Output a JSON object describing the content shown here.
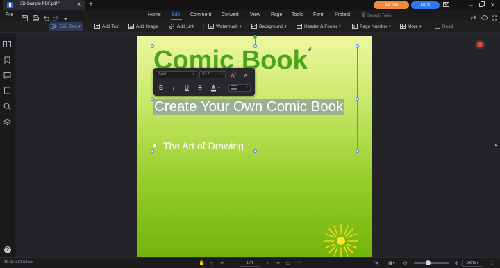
{
  "window": {
    "tab_title": "3D-Sample PDF.pdf *",
    "buy_now": "Buy now",
    "log_in": "Log in"
  },
  "menu": {
    "file": "File",
    "items": [
      "Home",
      "Edit",
      "Comment",
      "Convert",
      "View",
      "Page",
      "Tools",
      "Form",
      "Protect"
    ],
    "active": "Edit",
    "search_placeholder": "Search Tools"
  },
  "toolbar": {
    "edit_text": "Edit Text",
    "add_text": "Add Text",
    "add_image": "Add Image",
    "add_link": "Add Link",
    "watermark": "Watermark",
    "background": "Background",
    "header_footer": "Header & Footer",
    "page_number": "Page Number",
    "more": "More",
    "read": "Read"
  },
  "format_toolbar": {
    "font": "Arial",
    "size": "34.7"
  },
  "document": {
    "title": "Comic Book",
    "subtitle": "Create Your Own Comic Book",
    "bullet": "The Art of Drawing"
  },
  "status": {
    "dimensions": "19.05 x 27.52 cm",
    "page": "1 / 1",
    "zoom": "100%"
  },
  "colors": {
    "accent": "#4d8ff7",
    "buy_now": "#f08a3c",
    "log_in": "#2f78f0",
    "title_green": "#4aa41e"
  }
}
